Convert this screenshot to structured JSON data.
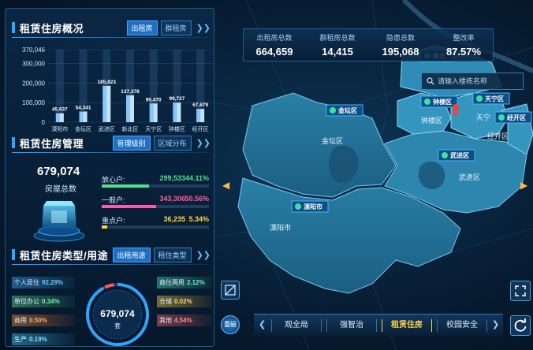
{
  "overview": {
    "title": "租赁住房概况",
    "tabs": [
      "出租房",
      "群租房"
    ],
    "chart_data": {
      "type": "bar",
      "categories": [
        "溧阳市",
        "金坛区",
        "武进区",
        "新北区",
        "天宁区",
        "钟楼区",
        "经开区"
      ],
      "values": [
        45637,
        54341,
        185823,
        137378,
        95470,
        99727,
        67679
      ],
      "value_labels": [
        "45,637",
        "54,341",
        "185,823",
        "137,378",
        "95,470",
        "99,727",
        "67,679"
      ],
      "y_ticks": [
        "0",
        "100,000",
        "200,000",
        "300,000",
        "370,046"
      ],
      "ylim": [
        0,
        370046
      ]
    }
  },
  "management": {
    "title": "租赁住房管理",
    "tabs": [
      "管理级别",
      "区域分布"
    ],
    "total": "679,074",
    "total_label": "房屋总数",
    "rows": [
      {
        "label": "放心户:",
        "value": "299,533",
        "pct": "44.11%",
        "ratio": 0.4411,
        "color": "#4fe08a"
      },
      {
        "label": "一般户:",
        "value": "343,306",
        "pct": "50.56%",
        "ratio": 0.5056,
        "color": "#ff5aa8"
      },
      {
        "label": "重点户:",
        "value": "36,235",
        "pct": "5.34%",
        "ratio": 0.0534,
        "color": "#ffd23a"
      }
    ]
  },
  "types": {
    "title": "租赁住房类型/用途",
    "tabs": [
      "出租用途",
      "租住类型"
    ],
    "total": "679,074",
    "unit": "套",
    "left_items": [
      {
        "label": "个人居住",
        "value": "92.29%",
        "color": "#3fa9ff"
      },
      {
        "label": "单位办公",
        "value": "0.34%",
        "color": "#56e08f"
      },
      {
        "label": "商用",
        "value": "0.50%",
        "color": "#ff8a3a"
      },
      {
        "label": "生产",
        "value": "0.19%",
        "color": "#3fd0ff"
      }
    ],
    "right_items": [
      {
        "label": "商住两用",
        "value": "2.12%",
        "color": "#42e0b0"
      },
      {
        "label": "仓储",
        "value": "0.02%",
        "color": "#ffc93a"
      },
      {
        "label": "其他",
        "value": "4.54%",
        "color": "#ff6a6a"
      }
    ]
  },
  "stats": [
    {
      "label": "出租房总数",
      "value": "664,659"
    },
    {
      "label": "群租房总数",
      "value": "14,415"
    },
    {
      "label": "隐患总数",
      "value": "195,068"
    },
    {
      "label": "整改率",
      "value": "87.57%"
    }
  ],
  "search": {
    "placeholder": "请输入楼栋名称"
  },
  "map_markers": [
    {
      "name": "金坛区",
      "label": "金坛区"
    },
    {
      "name": "溧阳市",
      "label": "溧阳市"
    },
    {
      "name": "钟楼区",
      "label": "钟楼区"
    },
    {
      "name": "天宁区",
      "label": "天宁区"
    },
    {
      "name": "经开区",
      "label": "经开区"
    },
    {
      "name": "武进区",
      "label": "武进区"
    },
    {
      "name": "新北区",
      "label": "新北"
    }
  ],
  "map_text": {
    "jintan": "金坛区",
    "liyang": "溧阳市",
    "zhonglou": "钟楼区",
    "tianning": "天宁",
    "jingkai": "经开区",
    "wujin": "武进区"
  },
  "nav": {
    "home": "重磁",
    "tabs": [
      "观全局",
      "强智治",
      "租赁住房",
      "校园安全"
    ],
    "active": "租赁住房"
  }
}
